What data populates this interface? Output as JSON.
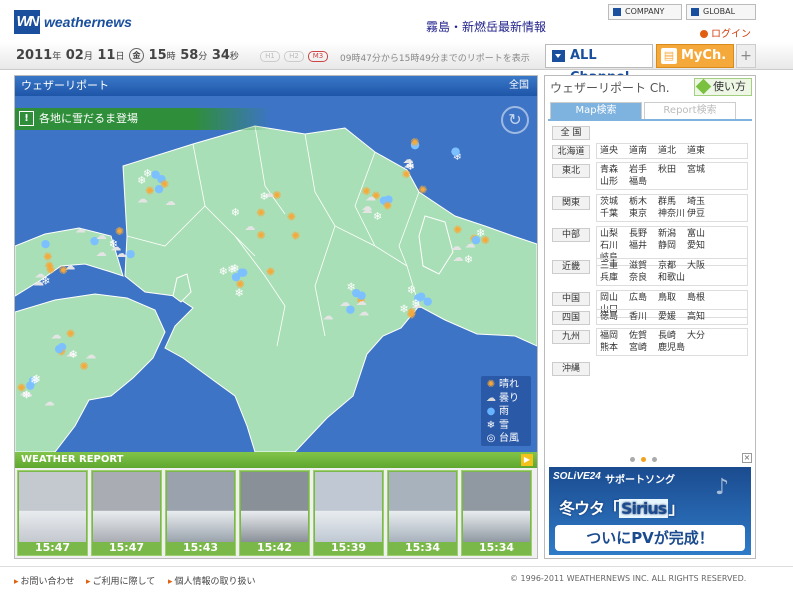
{
  "header": {
    "logo_mark": "WN",
    "logo_text": "weathernews",
    "headline": "霧島・新燃岳最新情報",
    "company": "COMPANY",
    "global": "GLOBAL",
    "login": "ログイン"
  },
  "timebar": {
    "year": "2011",
    "year_s": "年",
    "month": "02",
    "month_s": "月",
    "day": "11",
    "day_s": "日",
    "weekday": "金",
    "hour": "15",
    "hour_s": "時",
    "minute": "58",
    "minute_s": "分",
    "second": "34",
    "second_s": "秒",
    "h1": "H1",
    "h2": "H2",
    "m3": "M3",
    "range": "09時47分から15時49分までのリポートを表示",
    "all_channel": "ALL Channel",
    "my_channel": "MyCh.",
    "plus": "+"
  },
  "map": {
    "title": "ウェザーリポート",
    "region": "全国",
    "banner": "各地に雪だるま登場",
    "legend": [
      {
        "icon": "sun-icon",
        "glyph": "✺",
        "label": "晴れ",
        "color": "#f6a93b"
      },
      {
        "icon": "cloud-icon",
        "glyph": "☁",
        "label": "曇り",
        "color": "#d8d8d8"
      },
      {
        "icon": "raindrop-icon",
        "glyph": "💧",
        "label": "雨",
        "color": "#66b3ff"
      },
      {
        "icon": "snowflake-icon",
        "glyph": "❄",
        "label": "雪",
        "color": "#ffffff"
      },
      {
        "icon": "typhoon-icon",
        "glyph": "◎",
        "label": "台風",
        "color": "#ffffff"
      }
    ]
  },
  "weather_report": {
    "label": "WEATHER REPORT",
    "thumbnails": [
      {
        "time": "15:47",
        "bg": "#c4c8cf"
      },
      {
        "time": "15:47",
        "bg": "#a9adb3"
      },
      {
        "time": "15:43",
        "bg": "#9aa3ad"
      },
      {
        "time": "15:42",
        "bg": "#8a9098"
      },
      {
        "time": "15:39",
        "bg": "#bfc8d3"
      },
      {
        "time": "15:34",
        "bg": "#a8b2bd"
      },
      {
        "time": "15:34",
        "bg": "#9099a2"
      }
    ]
  },
  "right_panel": {
    "title": "ウェザーリポート Ch.",
    "howto": "使い方",
    "tab_map": "Map検索",
    "tab_report": "Report検索",
    "regions": [
      {
        "name": "全 国",
        "prefs": []
      },
      {
        "name": "北海道",
        "prefs": [
          "道央",
          "道南",
          "道北",
          "道東"
        ]
      },
      {
        "name": "東北",
        "prefs": [
          "青森",
          "岩手",
          "秋田",
          "宮城",
          "山形",
          "福島"
        ]
      },
      {
        "name": "関東",
        "prefs": [
          "茨城",
          "栃木",
          "群馬",
          "埼玉",
          "千葉",
          "東京",
          "神奈川",
          "伊豆"
        ]
      },
      {
        "name": "中部",
        "prefs": [
          "山梨",
          "長野",
          "新潟",
          "富山",
          "石川",
          "福井",
          "静岡",
          "愛知",
          "岐阜"
        ]
      },
      {
        "name": "近畿",
        "prefs": [
          "三重",
          "滋賀",
          "京都",
          "大阪",
          "兵庫",
          "奈良",
          "和歌山"
        ]
      },
      {
        "name": "中国",
        "prefs": [
          "岡山",
          "広島",
          "鳥取",
          "島根",
          "山口"
        ]
      },
      {
        "name": "四国",
        "prefs": [
          "徳島",
          "香川",
          "愛媛",
          "高知"
        ]
      },
      {
        "name": "九州",
        "prefs": [
          "福岡",
          "佐賀",
          "長崎",
          "大分",
          "熊本",
          "宮崎",
          "鹿児島"
        ]
      },
      {
        "name": "沖縄",
        "prefs": []
      }
    ],
    "ad": {
      "brand": "SOLiVE24",
      "song": "サポートソング",
      "main_pre": "冬ウタ「",
      "main_q": "Sirius",
      "main_post": "」",
      "sub": "ついにPVが完成！"
    }
  },
  "footer": {
    "contact": "お問い合わせ",
    "terms": "ご利用に際して",
    "privacy": "個人情報の取り扱い",
    "copyright": "© 1996-2011 WEATHERNEWS INC. ALL RIGHTS RESERVED."
  },
  "colors": {
    "brand_blue": "#1a4f9e",
    "accent_orange": "#f6a93b",
    "report_green": "#6fb63a",
    "sea": "#3d74c6",
    "land": "#a9dfb6"
  }
}
